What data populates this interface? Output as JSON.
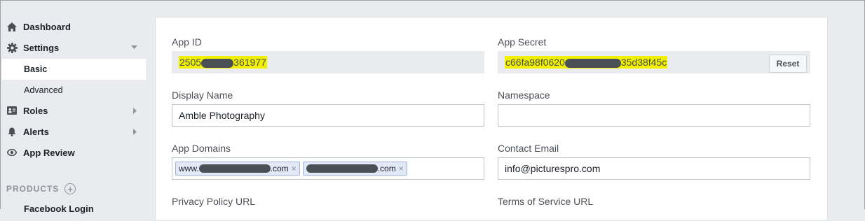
{
  "sidebar": {
    "dashboard": "Dashboard",
    "settings": "Settings",
    "basic": "Basic",
    "advanced": "Advanced",
    "roles": "Roles",
    "alerts": "Alerts",
    "app_review": "App Review",
    "products_heading": "PRODUCTS",
    "facebook_login": "Facebook Login"
  },
  "form": {
    "app_id": {
      "label": "App ID",
      "prefix": "2505",
      "suffix": "361977"
    },
    "app_secret": {
      "label": "App Secret",
      "prefix": "c66fa98f0620",
      "suffix": "35d38f45c",
      "reset_label": "Reset"
    },
    "display_name": {
      "label": "Display Name",
      "value": "Amble Photography"
    },
    "namespace": {
      "label": "Namespace",
      "value": ""
    },
    "app_domains": {
      "label": "App Domains",
      "tokens": [
        {
          "prefix": "www.",
          "suffix": ".com"
        },
        {
          "prefix": "",
          "suffix": ".com"
        }
      ],
      "remove_glyph": "×"
    },
    "contact_email": {
      "label": "Contact Email",
      "value": "info@picturespro.com"
    },
    "privacy_policy_url": {
      "label": "Privacy Policy URL"
    },
    "terms_of_service_url": {
      "label": "Terms of Service URL"
    }
  },
  "icons": {
    "dashboard": "home-icon",
    "settings": "gear-icon",
    "roles": "id-card-icon",
    "alerts": "bell-icon",
    "app_review": "eye-icon",
    "products_add": "plus-circle-icon"
  },
  "colors": {
    "page_bg": "#e9ebee",
    "card_bg": "#ffffff",
    "readonly_bg": "#e9ebee",
    "highlight": "#f0f000",
    "token_bg": "#e2e8f6"
  }
}
